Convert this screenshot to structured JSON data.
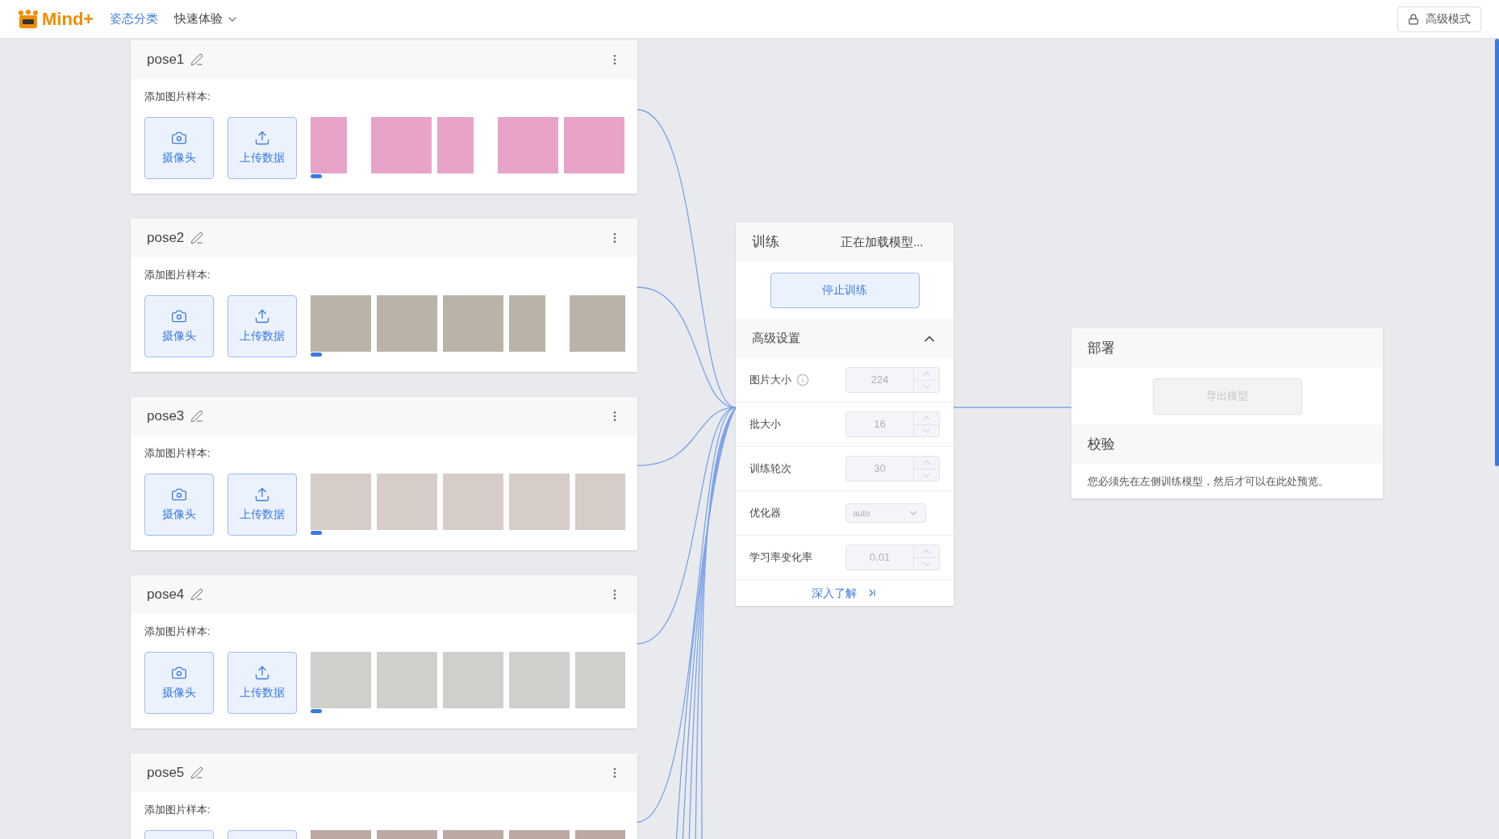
{
  "header": {
    "logo": "Mind+",
    "nav": [
      {
        "label": "姿态分类",
        "selected": true,
        "dropdown": false
      },
      {
        "label": "快速体验",
        "selected": false,
        "dropdown": true
      }
    ],
    "mode_button": "高级模式"
  },
  "classes": [
    {
      "name": "pose1",
      "add_label": "添加图片样本:",
      "buttons": [
        {
          "kind": "camera",
          "label": "摄像头"
        },
        {
          "kind": "upload",
          "label": "上传数据"
        }
      ],
      "samples": [
        {
          "kind": "narrow"
        },
        {
          "kind": "gap"
        },
        {
          "kind": "wide"
        },
        {
          "kind": "narrow"
        },
        {
          "kind": "gap"
        },
        {
          "kind": "wide"
        },
        {
          "kind": "wide"
        }
      ]
    },
    {
      "name": "pose2",
      "add_label": "添加图片样本:",
      "buttons": [
        {
          "kind": "camera",
          "label": "摄像头"
        },
        {
          "kind": "upload",
          "label": "上传数据"
        }
      ],
      "samples": [
        {
          "kind": "wide"
        },
        {
          "kind": "wide"
        },
        {
          "kind": "wide"
        },
        {
          "kind": "narrow"
        },
        {
          "kind": "gap"
        },
        {
          "kind": "wide"
        }
      ]
    },
    {
      "name": "pose3",
      "add_label": "添加图片样本:",
      "buttons": [
        {
          "kind": "camera",
          "label": "摄像头"
        },
        {
          "kind": "upload",
          "label": "上传数据"
        }
      ],
      "samples": [
        {
          "kind": "wide"
        },
        {
          "kind": "wide"
        },
        {
          "kind": "wide"
        },
        {
          "kind": "wide"
        },
        {
          "kind": "wide"
        }
      ]
    },
    {
      "name": "pose4",
      "add_label": "添加图片样本:",
      "buttons": [
        {
          "kind": "camera",
          "label": "摄像头"
        },
        {
          "kind": "upload",
          "label": "上传数据"
        }
      ],
      "samples": [
        {
          "kind": "wide"
        },
        {
          "kind": "wide"
        },
        {
          "kind": "wide"
        },
        {
          "kind": "wide"
        },
        {
          "kind": "wide"
        }
      ]
    },
    {
      "name": "pose5",
      "add_label": "添加图片样本:",
      "buttons": [
        {
          "kind": "camera"
        },
        {
          "kind": "upload"
        }
      ],
      "samples": [
        {
          "kind": "wide"
        },
        {
          "kind": "wide"
        },
        {
          "kind": "wide"
        },
        {
          "kind": "wide"
        },
        {
          "kind": "wide"
        }
      ]
    }
  ],
  "training": {
    "title": "训练",
    "status": "正在加载模型...",
    "stop_button": "停止训练",
    "advanced": {
      "title": "高级设置",
      "expanded": true,
      "settings": [
        {
          "kind": "number",
          "label": "图片大小",
          "info": true,
          "value": "224",
          "disabled": true
        },
        {
          "kind": "number",
          "label": "批大小",
          "info": false,
          "value": "16",
          "disabled": true
        },
        {
          "kind": "number",
          "label": "训练轮次",
          "info": false,
          "value": "30",
          "disabled": true
        },
        {
          "kind": "select",
          "label": "优化器",
          "info": false,
          "value": "auto",
          "disabled": true
        },
        {
          "kind": "number",
          "label": "学习率变化率",
          "info": false,
          "value": "0.01",
          "disabled": true
        }
      ]
    },
    "learn_more": "深入了解"
  },
  "deploy": {
    "title": "部署",
    "export_button": {
      "label": "导出模型",
      "disabled": true
    }
  },
  "preview": {
    "title": "校验",
    "message": "您必须先在左侧训练模型，然后才可以在此处预览。"
  }
}
